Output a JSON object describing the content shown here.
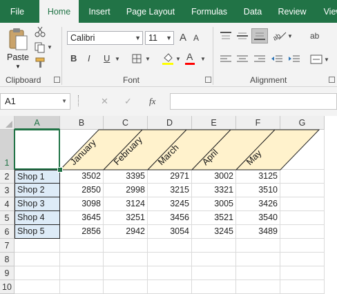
{
  "tabs": [
    "File",
    "Home",
    "Insert",
    "Page Layout",
    "Formulas",
    "Data",
    "Review",
    "View"
  ],
  "ribbon": {
    "clipboard": {
      "paste_label": "Paste",
      "group_label": "Clipboard"
    },
    "font": {
      "font_name": "Calibri",
      "font_size": "11",
      "bold": "B",
      "italic": "I",
      "underline": "U",
      "grow": "A",
      "shrink": "A",
      "font_color": "A",
      "group_label": "Font"
    },
    "alignment": {
      "group_label": "Alignment"
    },
    "wrap_label": "ab",
    "colors": {
      "accent": "#217346",
      "font_color_bar": "#ff0000",
      "fill_bar": "#ffff00"
    }
  },
  "formula_bar": {
    "name_box": "A1",
    "fx": "fx",
    "formula": ""
  },
  "sheet": {
    "columns": [
      "A",
      "B",
      "C",
      "D",
      "E",
      "F",
      "G"
    ],
    "rows": [
      "1",
      "2",
      "3",
      "4",
      "5",
      "6",
      "7",
      "8",
      "9",
      "10"
    ],
    "months": [
      "January",
      "February",
      "March",
      "April",
      "May"
    ],
    "shops": [
      "Shop 1",
      "Shop 2",
      "Shop 3",
      "Shop 4",
      "Shop 5"
    ],
    "values": [
      [
        "3502",
        "3395",
        "2971",
        "3002",
        "3125"
      ],
      [
        "2850",
        "2998",
        "3215",
        "3321",
        "3510"
      ],
      [
        "3098",
        "3124",
        "3245",
        "3005",
        "3426"
      ],
      [
        "3645",
        "3251",
        "3456",
        "3521",
        "3540"
      ],
      [
        "2856",
        "2942",
        "3054",
        "3245",
        "3489"
      ]
    ],
    "colors": {
      "header_fill": "#fff2cc",
      "shop_fill": "#ddebf7"
    }
  }
}
